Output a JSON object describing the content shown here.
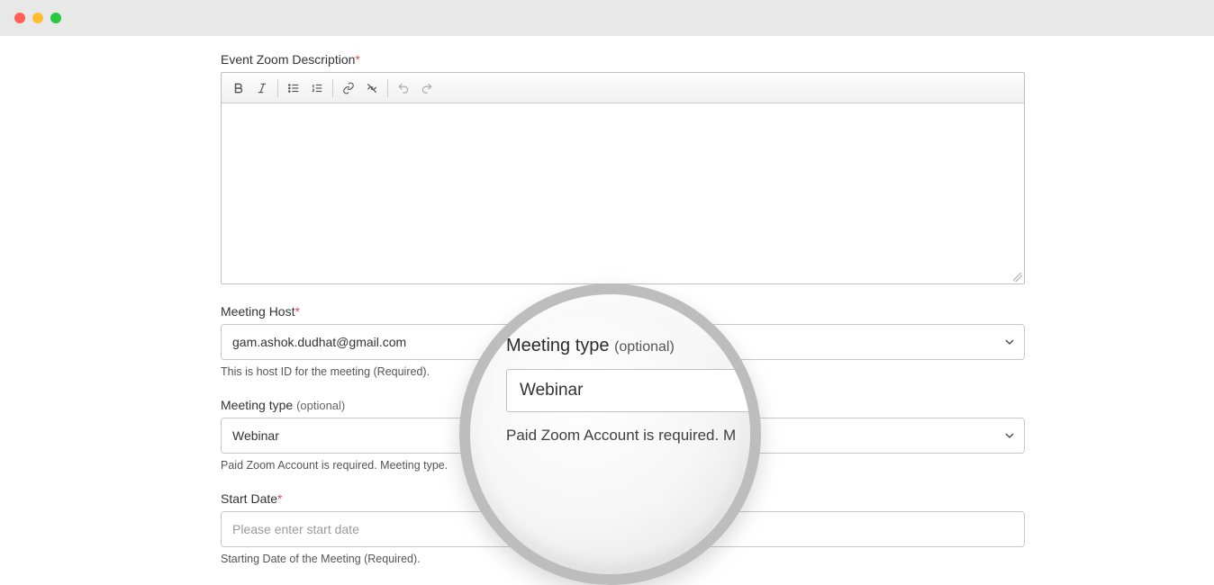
{
  "fields": {
    "description": {
      "label": "Event Zoom Description",
      "required_mark": "*"
    },
    "host": {
      "label": "Meeting Host",
      "required_mark": "*",
      "value": "gam.ashok.dudhat@gmail.com",
      "help": "This is host ID for the meeting (Required)."
    },
    "meeting_type": {
      "label": "Meeting type",
      "optional_text": "(optional)",
      "value": "Webinar",
      "help": "Paid Zoom Account is required. Meeting type."
    },
    "start_date": {
      "label": "Start Date",
      "required_mark": "*",
      "placeholder": "Please enter start date",
      "help": "Starting Date of the Meeting (Required)."
    }
  },
  "lens": {
    "label": "Meeting type",
    "optional_text": "(optional)",
    "value": "Webinar",
    "note": "Paid Zoom Account is required. M"
  }
}
